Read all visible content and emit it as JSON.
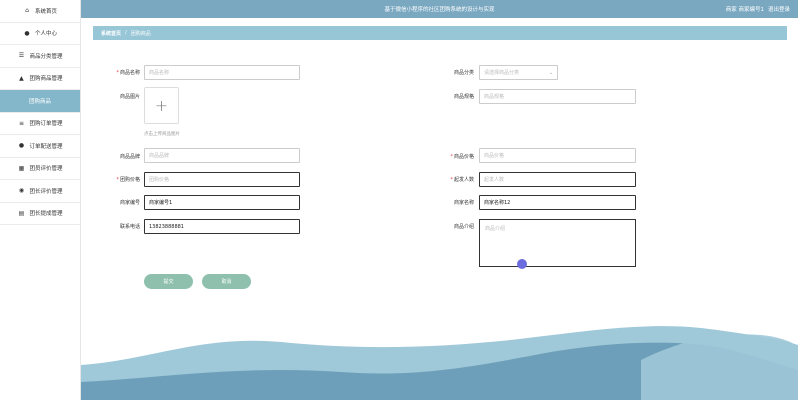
{
  "sidebar": {
    "items": [
      {
        "label": "系统首页",
        "icon": "home-icon",
        "glyph": "⌂",
        "active": false
      },
      {
        "label": "个人中心",
        "icon": "user-icon",
        "glyph": "●",
        "active": false
      },
      {
        "label": "商品分类管理",
        "icon": "sliders-icon",
        "glyph": "☰",
        "active": false
      },
      {
        "label": "团购商品管理",
        "icon": "user-tie-icon",
        "glyph": "▲",
        "active": false
      },
      {
        "label": "团购商品",
        "icon": "",
        "glyph": "",
        "active": true
      },
      {
        "label": "团购订单管理",
        "icon": "list-icon",
        "glyph": "≡",
        "active": false
      },
      {
        "label": "订单配送管理",
        "icon": "user-icon",
        "glyph": "●",
        "active": false
      },
      {
        "label": "团员评价管理",
        "icon": "grid-icon",
        "glyph": "▦",
        "active": false
      },
      {
        "label": "团长评价管理",
        "icon": "location-icon",
        "glyph": "◉",
        "active": false
      },
      {
        "label": "团长提成管理",
        "icon": "database-icon",
        "glyph": "▤",
        "active": false
      }
    ]
  },
  "header": {
    "title": "基于微信小程序的社区团购系统的设计与实现",
    "user": "商家 商家编号1",
    "logout": "退出登录"
  },
  "breadcrumb": {
    "home": "系统首页",
    "sep": "/",
    "current": "团购商品"
  },
  "form": {
    "product_name": {
      "label": "商品名称",
      "required": true,
      "placeholder": "商品名称",
      "value": ""
    },
    "category": {
      "label": "商品分类",
      "required": false,
      "placeholder": "请选择商品分类",
      "value": ""
    },
    "image": {
      "label": "商品图片",
      "tip": "点击上传商品图片"
    },
    "spec": {
      "label": "商品规格",
      "required": false,
      "placeholder": "商品规格",
      "value": ""
    },
    "brand": {
      "label": "商品品牌",
      "required": false,
      "placeholder": "商品品牌",
      "value": ""
    },
    "price": {
      "label": "商品价格",
      "required": true,
      "placeholder": "商品价格",
      "value": ""
    },
    "group_price": {
      "label": "团购价格",
      "required": true,
      "placeholder": "团购价格",
      "value": ""
    },
    "min_people": {
      "label": "起发人数",
      "required": true,
      "placeholder": "起发人数",
      "value": ""
    },
    "merchant_no": {
      "label": "商家编号",
      "required": false,
      "placeholder": "",
      "value": "商家编号1"
    },
    "merchant_name": {
      "label": "商家名称",
      "required": false,
      "placeholder": "",
      "value": "商家名称12"
    },
    "phone": {
      "label": "联系电话",
      "required": false,
      "placeholder": "",
      "value": "13823888881"
    },
    "intro": {
      "label": "商品介绍",
      "required": false,
      "placeholder": "商品介绍",
      "value": ""
    }
  },
  "buttons": {
    "submit": "提交",
    "cancel": "取消"
  },
  "colors": {
    "topbar": "#7aa8c1",
    "breadcrumb": "#97c6d6",
    "active_item": "#85b7cb",
    "button": "#8ec0ad",
    "required": "#e04040",
    "wave_light": "#9fc8d8",
    "wave_dark": "#6e9fba"
  }
}
